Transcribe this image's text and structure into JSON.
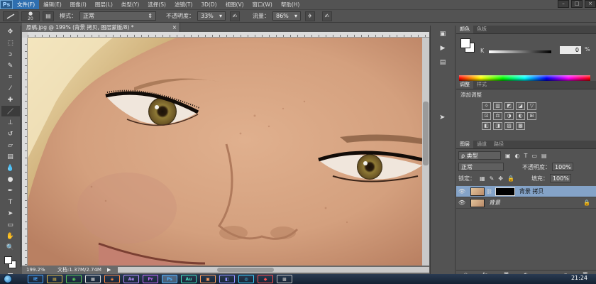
{
  "app": {
    "logo": "Ps",
    "menu": [
      "文件(F)",
      "编辑(E)",
      "图像(I)",
      "图层(L)",
      "类型(Y)",
      "选择(S)",
      "滤镜(T)",
      "3D(D)",
      "视图(V)",
      "窗口(W)",
      "帮助(H)"
    ],
    "window_controls": [
      "–",
      "□",
      "×"
    ]
  },
  "options": {
    "brush_size": "20",
    "mode_label": "模式：",
    "mode_value": "正常",
    "opacity_label": "不透明度：",
    "opacity_value": "33%",
    "flow_label": "流量：",
    "flow_value": "86%"
  },
  "document": {
    "tab_title": "原稿.jpg @ 199% (背景 拷贝, 图层蒙版/8) *",
    "tab_close": "×",
    "zoom": "199.2%",
    "doc_info": "文档:1.37M/2.74M",
    "arrow": "▶"
  },
  "tools": [
    {
      "name": "move-tool",
      "glyph": "✥"
    },
    {
      "name": "marquee-tool",
      "glyph": "⬚"
    },
    {
      "name": "lasso-tool",
      "glyph": "ↄ"
    },
    {
      "name": "quick-select-tool",
      "glyph": "✎"
    },
    {
      "name": "crop-tool",
      "glyph": "⌗"
    },
    {
      "name": "eyedropper-tool",
      "glyph": "⁄"
    },
    {
      "name": "healing-brush-tool",
      "glyph": "✚"
    },
    {
      "name": "brush-tool",
      "glyph": "／"
    },
    {
      "name": "clone-stamp-tool",
      "glyph": "⊥"
    },
    {
      "name": "history-brush-tool",
      "glyph": "↺"
    },
    {
      "name": "eraser-tool",
      "glyph": "▱"
    },
    {
      "name": "gradient-tool",
      "glyph": "▤"
    },
    {
      "name": "blur-tool",
      "glyph": "💧"
    },
    {
      "name": "dodge-tool",
      "glyph": "●"
    },
    {
      "name": "pen-tool",
      "glyph": "✒"
    },
    {
      "name": "type-tool",
      "glyph": "T"
    },
    {
      "name": "path-select-tool",
      "glyph": "➤"
    },
    {
      "name": "shape-tool",
      "glyph": "▭"
    },
    {
      "name": "hand-tool",
      "glyph": "✋"
    },
    {
      "name": "zoom-tool",
      "glyph": "🔍"
    }
  ],
  "mid_dock": [
    "▣",
    "▶",
    "▤"
  ],
  "color_panel": {
    "tabs": [
      "颜色",
      "色板"
    ],
    "channel": "K",
    "value": "0",
    "unit": "%"
  },
  "adjust_panel": {
    "tabs": [
      "调整",
      "样式"
    ],
    "title": "添加调整",
    "row1": [
      "☼",
      "▥",
      "◩",
      "◪",
      "▽"
    ],
    "row2": [
      "⊡",
      "⚖",
      "◑",
      "◐",
      "⊞"
    ],
    "row3": [
      "◧",
      "◨",
      "▨",
      "▩"
    ]
  },
  "layers_panel": {
    "tabs": [
      "图层",
      "通道",
      "路径"
    ],
    "filter_label": "ρ 类型",
    "blend_mode": "正常",
    "opacity_label": "不透明度：",
    "opacity_value": "100%",
    "lock_label": "锁定：",
    "fill_label": "填充：",
    "fill_value": "100%",
    "layers": [
      {
        "name": "背景 拷贝",
        "selected": true
      },
      {
        "name": "背景",
        "selected": false
      }
    ],
    "footer": [
      "⊖",
      "fx.",
      "◙",
      "◐.",
      "▭",
      "▪",
      "🗑"
    ]
  },
  "taskbar": {
    "apps": [
      {
        "label": "IE",
        "color": "#4aa6ff"
      },
      {
        "label": "▤",
        "color": "#e8c048"
      },
      {
        "label": "◉",
        "color": "#58c858"
      },
      {
        "label": "▦",
        "color": "#d6d6d6"
      },
      {
        "label": "◈",
        "color": "#ff8844"
      },
      {
        "label": "Ae",
        "color": "#b58cff"
      },
      {
        "label": "Pr",
        "color": "#c86cff"
      },
      {
        "label": "Ps",
        "color": "#4fb3ff",
        "active": true
      },
      {
        "label": "Au",
        "color": "#44e0c0"
      },
      {
        "label": "▣",
        "color": "#ffa060"
      },
      {
        "label": "◧",
        "color": "#9090ff"
      },
      {
        "label": "◎",
        "color": "#40d0ff"
      },
      {
        "label": "◆",
        "color": "#ff5050"
      },
      {
        "label": "▩",
        "color": "#c0c0c0"
      }
    ],
    "time": "21:24"
  }
}
